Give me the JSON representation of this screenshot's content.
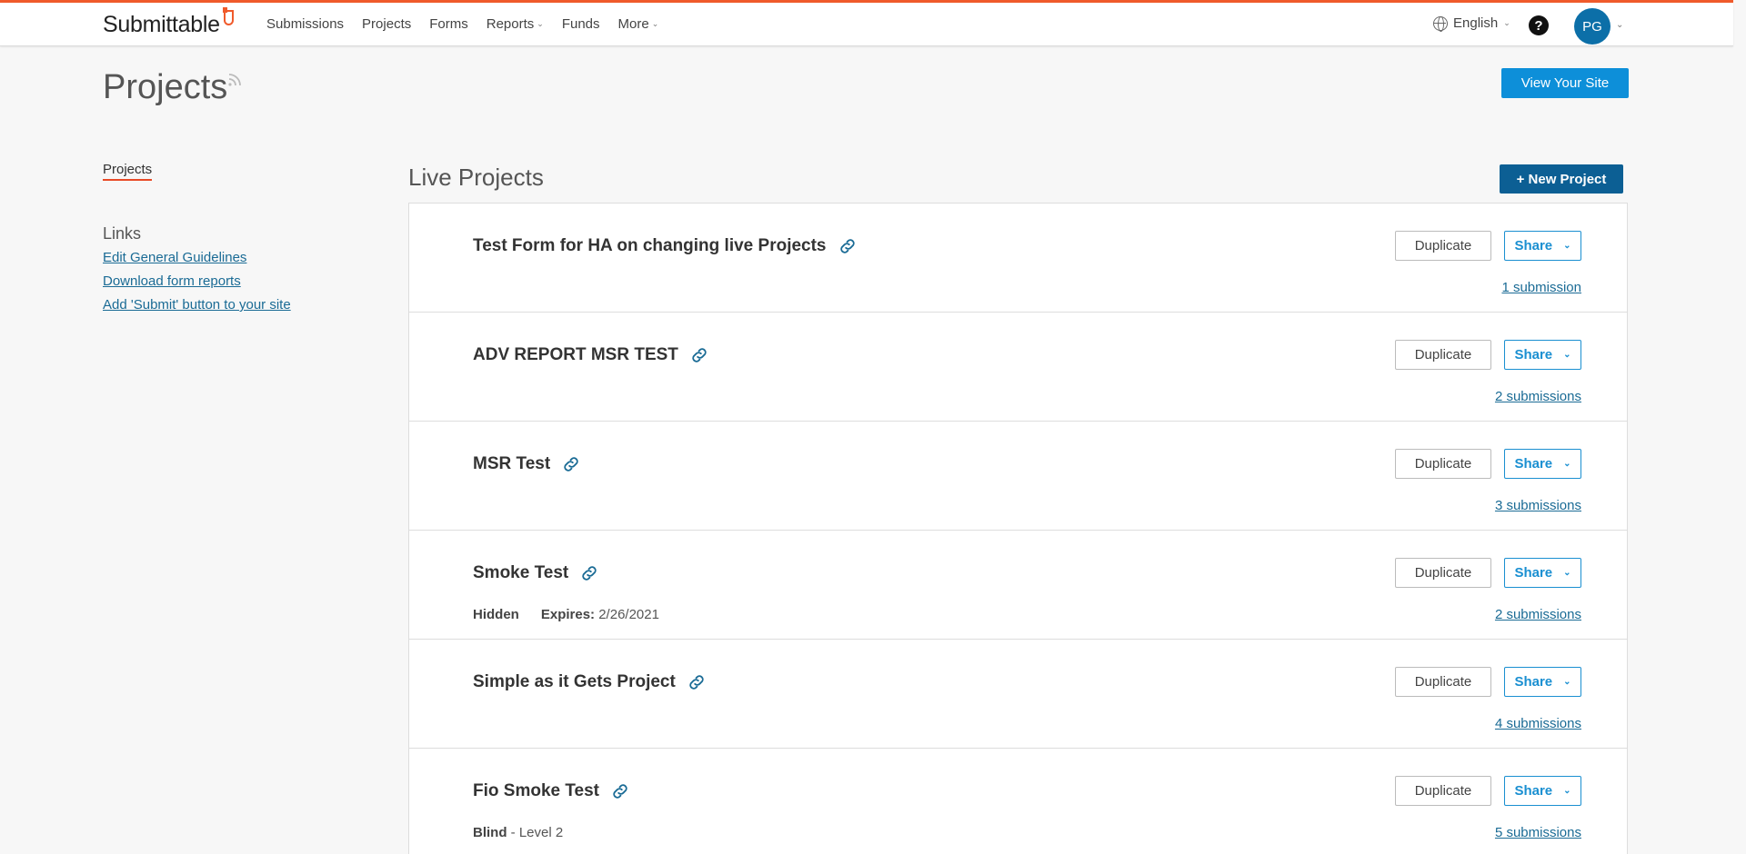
{
  "app": {
    "logo_text": "Submittable"
  },
  "nav": {
    "items": [
      {
        "label": "Submissions",
        "caret": false
      },
      {
        "label": "Projects",
        "caret": false
      },
      {
        "label": "Forms",
        "caret": false
      },
      {
        "label": "Reports",
        "caret": true
      },
      {
        "label": "Funds",
        "caret": false
      },
      {
        "label": "More",
        "caret": true
      }
    ],
    "language": "English",
    "help": "?",
    "avatar_initials": "PG"
  },
  "header": {
    "page_title": "Projects",
    "view_site_button": "View Your Site"
  },
  "sidebar": {
    "active_item": "Projects",
    "links_heading": "Links",
    "links": [
      "Edit General Guidelines",
      "Download form reports",
      "Add 'Submit' button to your site"
    ]
  },
  "main": {
    "section_title": "Live Projects",
    "new_project_button": "+ New Project",
    "duplicate_label": "Duplicate",
    "share_label": "Share",
    "projects": [
      {
        "name": "Test Form for HA on changing live Projects",
        "submissions": "1 submission",
        "meta": []
      },
      {
        "name": "ADV REPORT MSR TEST",
        "submissions": "2 submissions",
        "meta": []
      },
      {
        "name": "MSR Test",
        "submissions": "3 submissions",
        "meta": []
      },
      {
        "name": "Smoke Test",
        "submissions": "2 submissions",
        "meta": [
          {
            "bold": "Hidden",
            "text": ""
          },
          {
            "bold": "Expires:",
            "text": " 2/26/2021"
          }
        ]
      },
      {
        "name": "Simple as it Gets Project",
        "submissions": "4 submissions",
        "meta": []
      },
      {
        "name": "Fio Smoke Test",
        "submissions": "5 submissions",
        "meta": [
          {
            "bold": "Blind",
            "text": " - Level 2"
          }
        ]
      }
    ]
  },
  "colors": {
    "accent": "#f05a2b",
    "primary": "#0c5f94",
    "link": "#1a6b95"
  }
}
